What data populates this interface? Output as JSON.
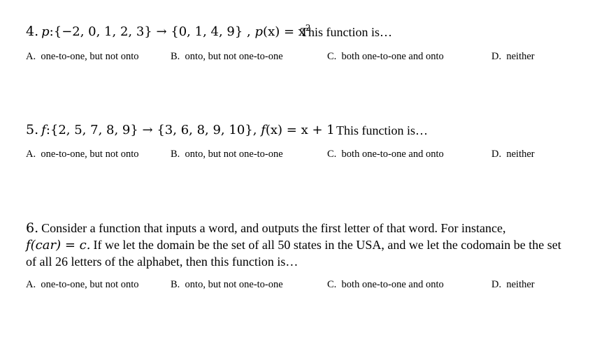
{
  "questions": [
    {
      "number": "4.",
      "func_name": "p",
      "domain_set": ":{−2, 0, 1, 2, 3} → {0, 1, 4, 9} ,",
      "rule_lhs": "p",
      "rule_arg": "(x) = x",
      "rule_exp": "2",
      "prompt": "This function is…",
      "options": [
        {
          "letter": "A.",
          "text": "one-to-one, but not onto"
        },
        {
          "letter": "B.",
          "text": "onto, but not one-to-one"
        },
        {
          "letter": "C.",
          "text": "both one-to-one and onto"
        },
        {
          "letter": "D.",
          "text": "neither"
        }
      ]
    },
    {
      "number": "5.",
      "func_name": "f",
      "domain_set": ":{2, 5, 7, 8, 9} → {3, 6, 8, 9, 10},",
      "rule_lhs": "f",
      "rule_arg": "(x) = x + 1",
      "prompt": "This function is…",
      "options": [
        {
          "letter": "A.",
          "text": "one-to-one, but not onto"
        },
        {
          "letter": "B.",
          "text": "onto, but not one-to-one"
        },
        {
          "letter": "C.",
          "text": "both one-to-one and onto"
        },
        {
          "letter": "D.",
          "text": "neither"
        }
      ]
    },
    {
      "number": "6.",
      "line1": "Consider a function that inputs a word, and outputs the first letter of that word.  For instance,",
      "line2_math": "f(car) = c.",
      "line2_rest": "If we let the domain be the set of all 50 states in the USA, and we let the codomain be the set",
      "line3": "of all 26 letters of the alphabet, then this function is…",
      "options": [
        {
          "letter": "A.",
          "text": "one-to-one, but not onto"
        },
        {
          "letter": "B.",
          "text": "onto, but not one-to-one"
        },
        {
          "letter": "C.",
          "text": "both one-to-one and onto"
        },
        {
          "letter": "D.",
          "text": "neither"
        }
      ]
    }
  ]
}
